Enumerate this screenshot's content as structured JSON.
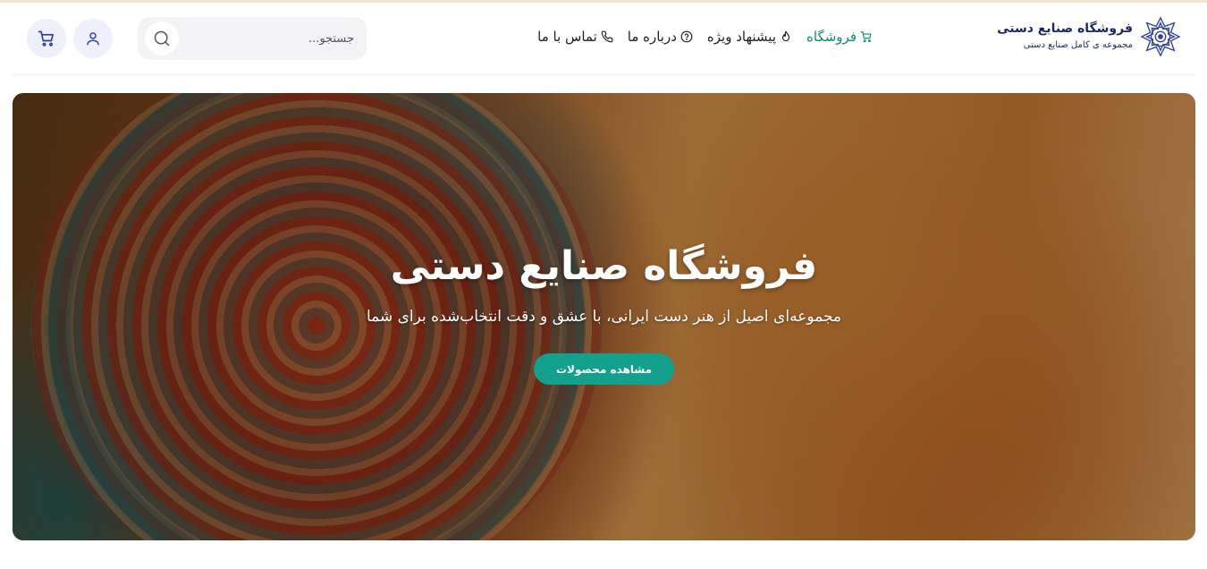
{
  "brand": {
    "title": "فروشگاه صنایع دستی",
    "subtitle": "مجموعه ی کامل صنایع دستی",
    "logo_icon": "mandala-logo-icon"
  },
  "nav": {
    "items": [
      {
        "label": "فروشگاه",
        "icon": "cart-icon",
        "active": true
      },
      {
        "label": "پیشنهاد ویژه",
        "icon": "fire-icon",
        "active": false
      },
      {
        "label": "درباره ما",
        "icon": "help-circle-icon",
        "active": false
      },
      {
        "label": "تماس با ما",
        "icon": "phone-icon",
        "active": false
      }
    ]
  },
  "search": {
    "placeholder": "جستجو...",
    "value": "",
    "icon": "search-icon"
  },
  "actions": {
    "user_icon": "user-icon",
    "cart_icon": "cart-icon"
  },
  "hero": {
    "title": "فروشگاه صنایع دستی",
    "subtitle": "مجموعه‌ای اصیل از هنر دست ایرانی، با عشق و دقت انتخاب‌شده برای شما",
    "cta_label": "مشاهده محصولات"
  },
  "colors": {
    "brand_navy": "#1c2a6b",
    "active_green": "#0f8a73",
    "cta_teal": "#13a08c",
    "icon_button_bg": "#eef0fb"
  }
}
